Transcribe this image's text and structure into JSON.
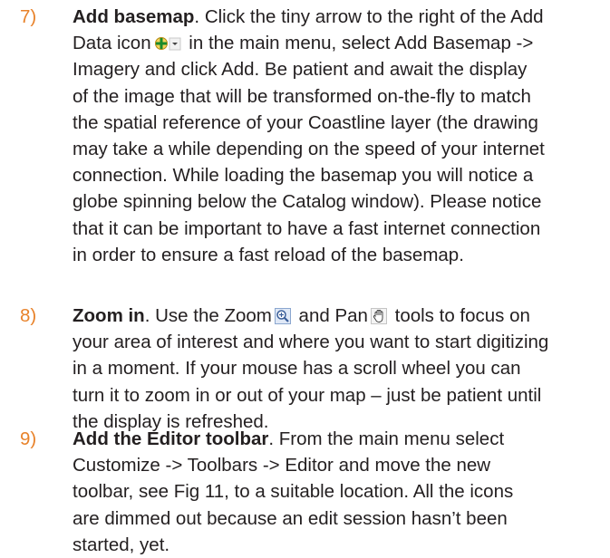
{
  "steps": [
    {
      "number": "7)",
      "title": "Add basemap",
      "lines": [
        ". Click the tiny arrow to the right of the Add",
        "Data icon",
        " in the main menu, select Add Basemap ->",
        "Imagery and click Add. Be patient and await the display",
        "of the image that will be transformed on-the-fly to match",
        "the spatial reference of your Coastline layer (the drawing",
        "may take a while depending on the speed of your internet",
        "connection. While loading the basemap you will notice a",
        "globe spinning below the Catalog window). Please notice",
        "that it can be important to have a fast internet connection",
        "in order to ensure a fast reload of the basemap."
      ],
      "icons": [
        "add-data-icon"
      ]
    },
    {
      "number": "8)",
      "title": "Zoom in",
      "lines": [
        ". Use the Zoom",
        " and Pan",
        " tools to focus on",
        "your area of interest and where you want to start digitizing",
        "in a moment. If your mouse has a scroll wheel you can",
        "turn it to zoom in or out of your map – just be patient until",
        "the display is refreshed."
      ],
      "icons": [
        "zoom-in-icon",
        "pan-hand-icon"
      ]
    },
    {
      "number": "9)",
      "title": "Add the Editor toolbar",
      "lines": [
        ". From the main menu select",
        "Customize -> Toolbars -> Editor and move the new",
        "toolbar, see Fig 11, to a suitable location. All the icons",
        "are dimmed out because an edit session hasn’t been",
        "started, yet."
      ]
    }
  ],
  "colors": {
    "step_number": "#e8822a",
    "text": "#231f20"
  }
}
